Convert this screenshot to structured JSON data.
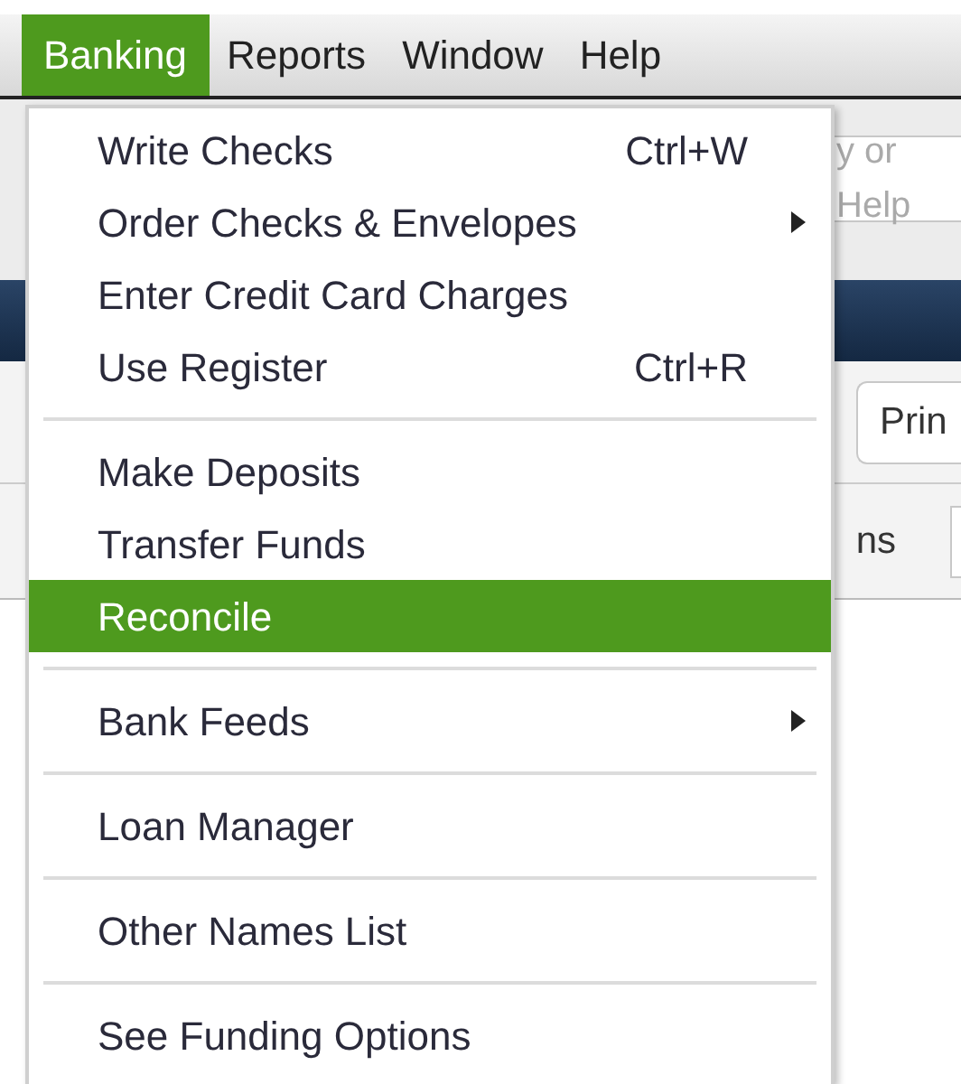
{
  "menubar": {
    "items": [
      {
        "label": "Banking",
        "selected": true
      },
      {
        "label": "Reports",
        "selected": false
      },
      {
        "label": "Window",
        "selected": false
      },
      {
        "label": "Help",
        "selected": false
      }
    ]
  },
  "background": {
    "search_field": {
      "placeholder": "y or Help"
    },
    "toolbar_button": {
      "label": "Prin"
    },
    "columns_label": {
      "label": "ns"
    }
  },
  "menu": {
    "items": [
      {
        "kind": "item",
        "label": "Write Checks",
        "shortcut": "Ctrl+W",
        "submenu": false,
        "selected": false
      },
      {
        "kind": "item",
        "label": "Order Checks & Envelopes",
        "submenu": true,
        "selected": false
      },
      {
        "kind": "item",
        "label": "Enter Credit Card Charges",
        "submenu": false,
        "selected": false
      },
      {
        "kind": "item",
        "label": "Use Register",
        "shortcut": "Ctrl+R",
        "submenu": false,
        "selected": false
      },
      {
        "kind": "separator"
      },
      {
        "kind": "item",
        "label": "Make Deposits",
        "submenu": false,
        "selected": false
      },
      {
        "kind": "item",
        "label": "Transfer Funds",
        "submenu": false,
        "selected": false
      },
      {
        "kind": "item",
        "label": "Reconcile",
        "submenu": false,
        "selected": true
      },
      {
        "kind": "separator"
      },
      {
        "kind": "item",
        "label": "Bank Feeds",
        "submenu": true,
        "selected": false
      },
      {
        "kind": "separator"
      },
      {
        "kind": "item",
        "label": "Loan Manager",
        "submenu": false,
        "selected": false
      },
      {
        "kind": "separator"
      },
      {
        "kind": "item",
        "label": "Other Names List",
        "submenu": false,
        "selected": false
      },
      {
        "kind": "separator"
      },
      {
        "kind": "item",
        "label": "See Funding Options",
        "submenu": false,
        "selected": false
      }
    ]
  }
}
